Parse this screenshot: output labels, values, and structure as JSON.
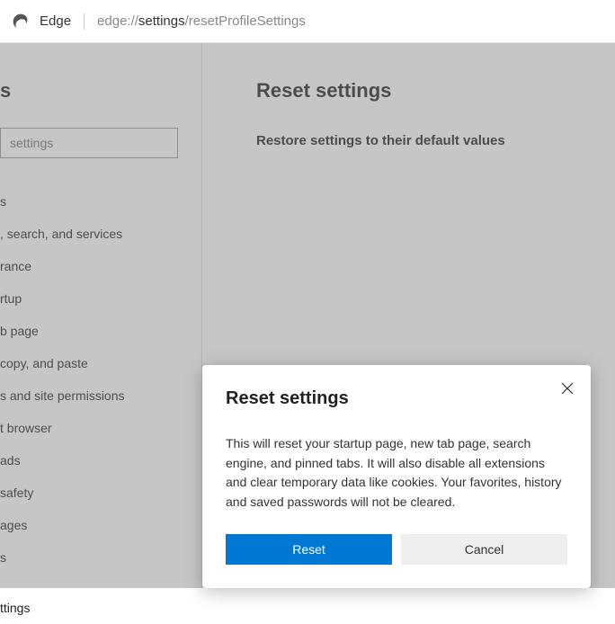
{
  "addressBar": {
    "browserLabel": "Edge",
    "urlPrefix": "edge://",
    "urlMiddle": "settings",
    "urlSuffix": "/resetProfileSettings"
  },
  "sidebar": {
    "titleFragment": "s",
    "searchPlaceholder": "settings",
    "items": [
      "s",
      ", search, and services",
      "rance",
      "rtup",
      "b page",
      "copy, and paste",
      "s and site permissions",
      "t browser",
      "ads",
      "safety",
      "ages",
      "s",
      "",
      "ttings"
    ]
  },
  "main": {
    "title": "Reset settings",
    "subtitle": "Restore settings to their default values"
  },
  "dialog": {
    "title": "Reset settings",
    "body": "This will reset your startup page, new tab page, search engine, and pinned tabs. It will also disable all extensions and clear temporary data like cookies. Your favorites, history and saved passwords will not be cleared.",
    "primaryButton": "Reset",
    "secondaryButton": "Cancel"
  }
}
